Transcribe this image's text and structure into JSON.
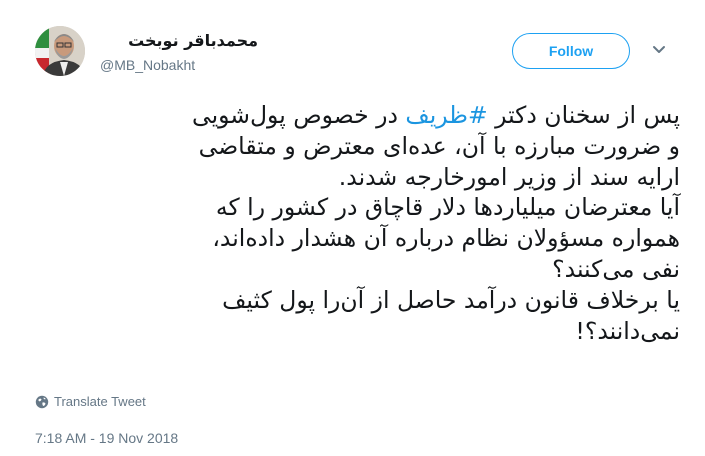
{
  "header": {
    "display_name": "محمدباقر نوبخت",
    "handle": "@MB_Nobakht",
    "follow_label": "Follow",
    "caret_icon": "chevron-down-icon",
    "avatar_icon": "avatar"
  },
  "tweet": {
    "line1_prefix": "پس از سخنان دکتر ",
    "line1_hashtag": "#ظریف",
    "line1_suffix": " در خصوص پول‌شویی",
    "line2": "و ضرورت مبارزه با آن، عده‌ای معترض و متقاضی",
    "line3": "ارایه سند از وزیر امورخارجه شدند.",
    "line4": "آیا معترضان میلیاردها دلار قاچاق در کشور را که",
    "line5": "همواره مسؤولان نظام درباره آن هشدار داده‌اند،",
    "line6": "نفی می‌کنند؟",
    "line7": "یا برخلاف قانون درآمد حاصل از آن‌را پول کثیف",
    "line8": "نمی‌دانند؟!"
  },
  "footer": {
    "translate_label": "Translate Tweet",
    "translate_icon": "globe-icon",
    "timestamp": "7:18 AM - 19 Nov 2018"
  },
  "colors": {
    "accent": "#1da1f2",
    "hashtag": "#1b95e0",
    "text": "#14171a",
    "muted": "#657786"
  }
}
